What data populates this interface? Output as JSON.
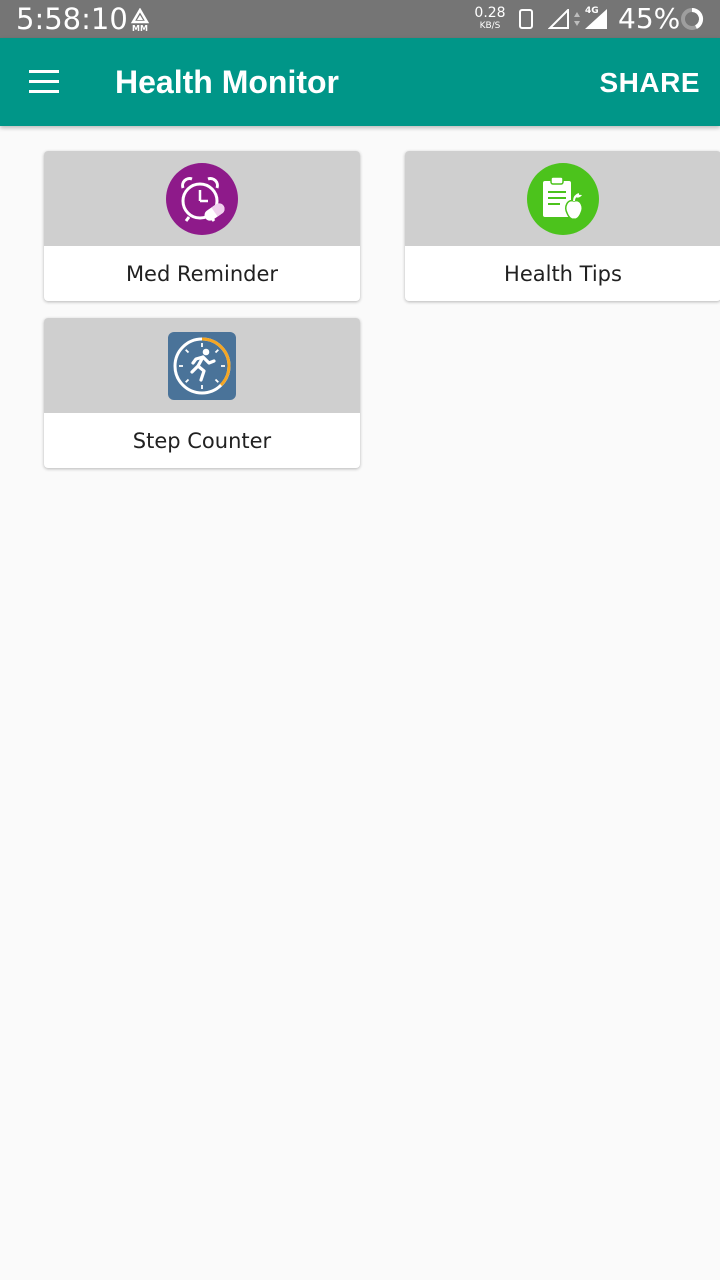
{
  "status_bar": {
    "time": "5:58:10",
    "speed_value": "0.28",
    "speed_unit": "KB/S",
    "network": "4G",
    "battery": "45%"
  },
  "app_bar": {
    "title": "Health Monitor",
    "share_label": "SHARE",
    "color": "#009688"
  },
  "cards": [
    {
      "label": "Med Reminder",
      "icon": "alarm-clock-pill-icon",
      "icon_color": "#8e1a8a"
    },
    {
      "label": "Health Tips",
      "icon": "clipboard-apple-icon",
      "icon_color": "#4cc31c"
    },
    {
      "label": "Step Counter",
      "icon": "stopwatch-runner-icon",
      "icon_color": "#4a7399"
    }
  ]
}
